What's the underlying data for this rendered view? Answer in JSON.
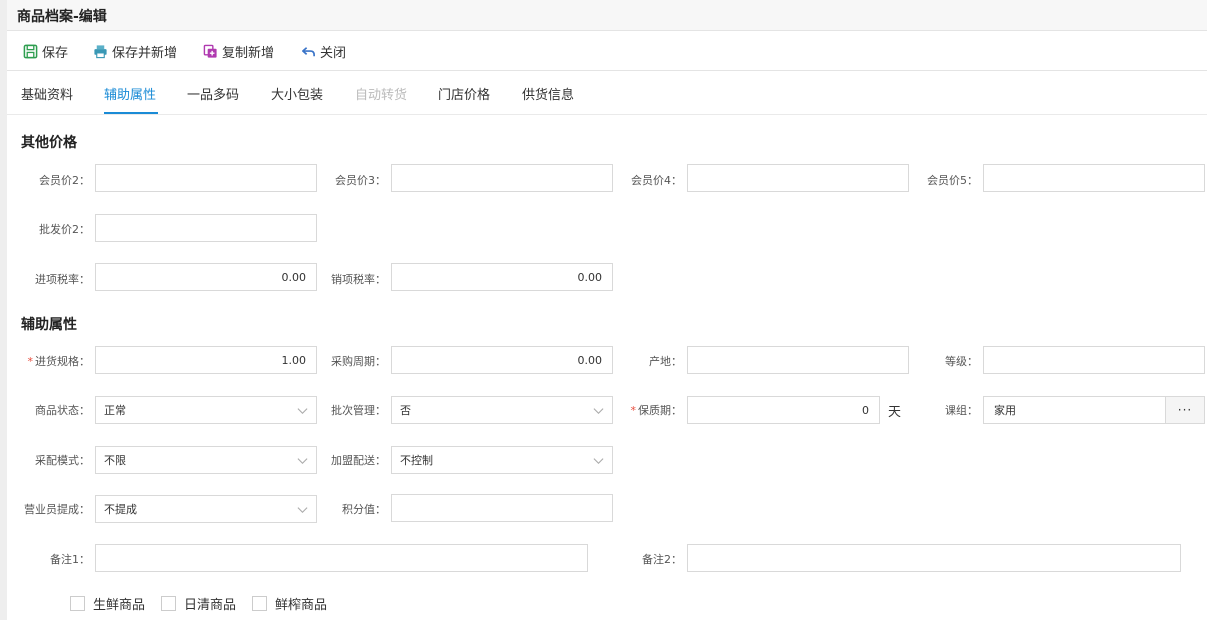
{
  "window": {
    "title": "商品档案-编辑"
  },
  "toolbar": {
    "save": "保存",
    "save_and_new": "保存并新增",
    "copy_new": "复制新增",
    "close": "关闭"
  },
  "tabs": [
    {
      "label": "基础资料",
      "state": "normal"
    },
    {
      "label": "辅助属性",
      "state": "active"
    },
    {
      "label": "一品多码",
      "state": "normal"
    },
    {
      "label": "大小包装",
      "state": "normal"
    },
    {
      "label": "自动转货",
      "state": "disabled"
    },
    {
      "label": "门店价格",
      "state": "normal"
    },
    {
      "label": "供货信息",
      "state": "normal"
    }
  ],
  "other_prices": {
    "title": "其他价格",
    "member_price2": {
      "label": "会员价2：",
      "value": ""
    },
    "member_price3": {
      "label": "会员价3：",
      "value": ""
    },
    "member_price4": {
      "label": "会员价4：",
      "value": ""
    },
    "member_price5": {
      "label": "会员价5：",
      "value": ""
    },
    "wholesale_price2": {
      "label": "批发价2：",
      "value": ""
    },
    "input_tax": {
      "label": "进项税率：",
      "value": "0.00"
    },
    "output_tax": {
      "label": "销项税率：",
      "value": "0.00"
    }
  },
  "aux_attrs": {
    "title": "辅助属性",
    "purchase_spec": {
      "label": "进货规格：",
      "value": "1.00",
      "required": "*"
    },
    "purchase_cycle": {
      "label": "采购周期：",
      "value": "0.00"
    },
    "origin": {
      "label": "产地：",
      "value": ""
    },
    "grade": {
      "label": "等级：",
      "value": ""
    },
    "product_status": {
      "label": "商品状态：",
      "value": "正常"
    },
    "batch_mgmt": {
      "label": "批次管理：",
      "value": "否"
    },
    "shelf_life": {
      "label": "保质期：",
      "value": "0",
      "unit": "天",
      "required": "*"
    },
    "course_group": {
      "label": "课组：",
      "value": "家用",
      "button": "···"
    },
    "distribution_mode": {
      "label": "采配模式：",
      "value": "不限"
    },
    "franchise_delivery": {
      "label": "加盟配送：",
      "value": "不控制"
    },
    "salesperson_commission": {
      "label": "营业员提成：",
      "value": "不提成"
    },
    "points": {
      "label": "积分值：",
      "value": ""
    },
    "remark1": {
      "label": "备注1：",
      "value": ""
    },
    "remark2": {
      "label": "备注2：",
      "value": ""
    }
  },
  "checkboxes": [
    {
      "label": "生鲜商品",
      "checked": false
    },
    {
      "label": "日清商品",
      "checked": false
    },
    {
      "label": "鲜榨商品",
      "checked": false
    }
  ],
  "colors": {
    "accent": "#1a8bd6",
    "required": "#e74c3c",
    "border": "#d9d9d9"
  },
  "icons": {
    "save": "save-icon",
    "save_and_new": "printer-icon",
    "copy_new": "copy-add-icon",
    "close": "undo-arrow-icon"
  }
}
